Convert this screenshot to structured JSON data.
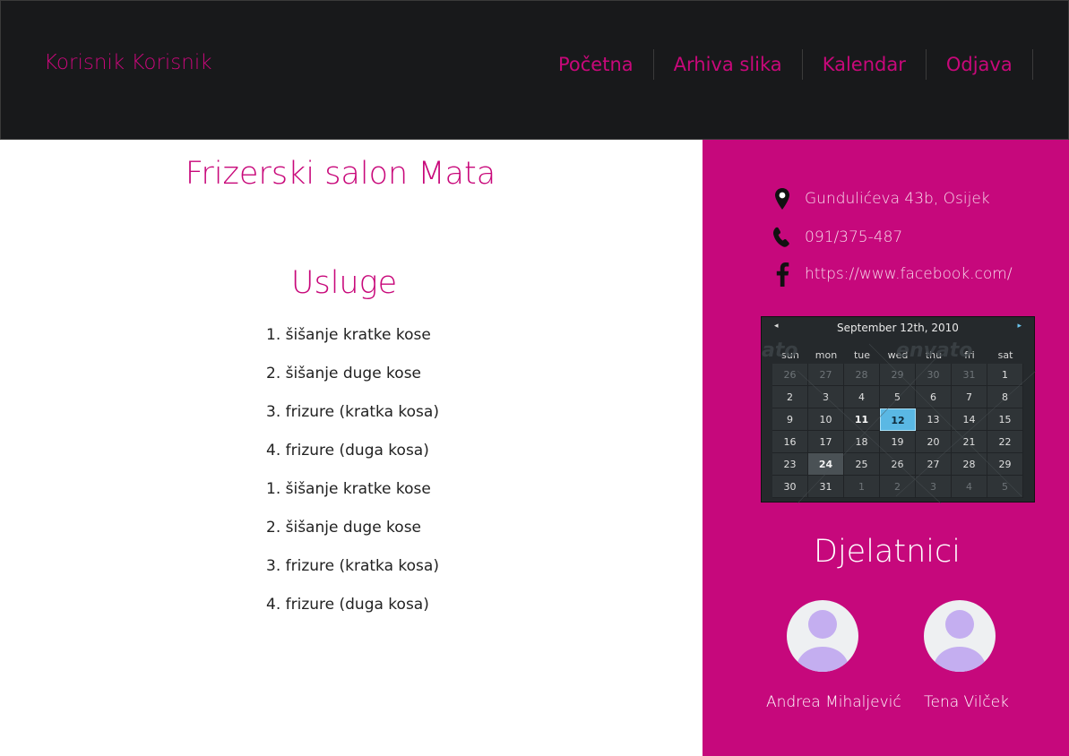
{
  "header": {
    "brand": "Korisnik Korisnik",
    "nav": [
      "Početna",
      "Arhiva slika",
      "Kalendar",
      "Odjava"
    ]
  },
  "main": {
    "title": "Frizerski salon Mata",
    "services_title": "Usluge",
    "services": [
      "1. šišanje kratke kose",
      "2. šišanje duge kose",
      "3. frizure (kratka kosa)",
      "4. frizure (duga kosa)",
      "1. šišanje kratke kose",
      "2. šišanje duge kose",
      "3. frizure (kratka kosa)",
      "4. frizure (duga kosa)"
    ]
  },
  "sidebar": {
    "address": "Gundulićeva 43b, Osijek",
    "phone": "091/375-487",
    "facebook": "https://www.facebook.com/",
    "calendar": {
      "month_label": "September 12th, 2010",
      "prev": "◂",
      "next": "▸",
      "weekdays": [
        "sun",
        "mon",
        "tue",
        "wed",
        "thu",
        "fri",
        "sat"
      ],
      "days": [
        "26",
        "27",
        "28",
        "29",
        "30",
        "31",
        "1",
        "2",
        "3",
        "4",
        "5",
        "6",
        "7",
        "8",
        "9",
        "10",
        "11",
        "12",
        "13",
        "14",
        "15",
        "16",
        "17",
        "18",
        "19",
        "20",
        "21",
        "22",
        "23",
        "24",
        "25",
        "26",
        "27",
        "28",
        "29",
        "30",
        "31",
        "1",
        "2",
        "3",
        "4",
        "5"
      ],
      "selected": "12",
      "watermark": "envato"
    },
    "staff_title": "Djelatnici",
    "staff": [
      "Andrea Mihaljević",
      "Tena Vilček"
    ]
  },
  "colors": {
    "accent": "#c8087a",
    "header_bg": "#18191b",
    "sidebar_bg": "#c6087c",
    "avatar": "#c4aef0"
  }
}
